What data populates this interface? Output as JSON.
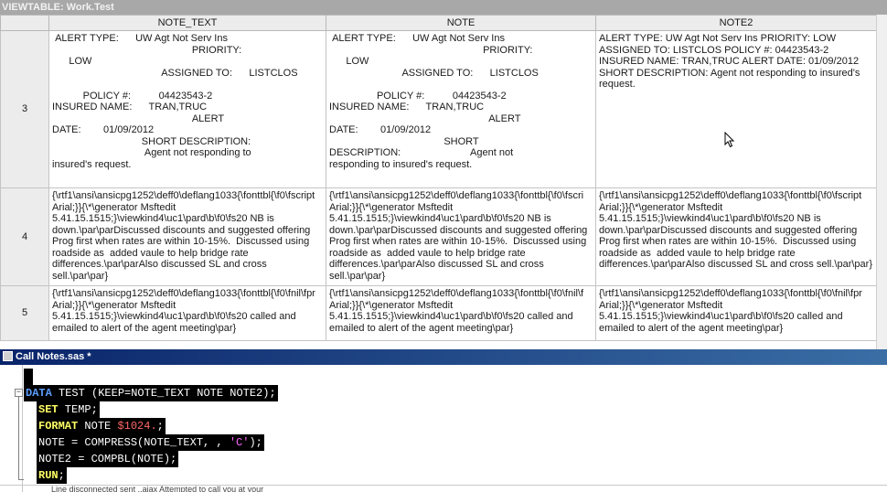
{
  "viewtable_title": "VIEWTABLE: Work.Test",
  "columns": [
    "NOTE_TEXT",
    "NOTE",
    "NOTE2"
  ],
  "rows": [
    {
      "num": "3",
      "note_text": " ALERT TYPE:      UW Agt Not Serv Ins\n                                                  PRIORITY:\n      LOW\n                                       ASSIGNED TO:      LISTCLOS\n\n           POLICY #:          04423543-2\nINSURED NAME:      TRAN,TRUC\n                                                  ALERT\nDATE:        01/09/2012\n                                SHORT DESCRIPTION:\n                                 Agent not responding to\ninsured's request.",
      "note": " ALERT TYPE:      UW Agt Not Serv Ins\n                                                       PRIORITY:\n      LOW\n                          ASSIGNED TO:      LISTCLOS\n\n                 POLICY #:          04423543-2\nINSURED NAME:      TRAN,TRUC\n                                                         ALERT\nDATE:        01/09/2012\n                                         SHORT\nDESCRIPTION:                         Agent not\nresponding to insured's request.",
      "note2": "ALERT TYPE: UW Agt Not Serv Ins PRIORITY: LOW ASSIGNED TO: LISTCLOS POLICY #: 04423543-2 INSURED NAME: TRAN,TRUC ALERT DATE: 01/09/2012 SHORT DESCRIPTION: Agent not responding to insured's request."
    },
    {
      "num": "4",
      "note_text": "{\\rtf1\\ansi\\ansicpg1252\\deff0\\deflang1033{\\fonttbl{\\f0\\fscript Arial;}}{\\*\\generator Msftedit 5.41.15.1515;}\\viewkind4\\uc1\\pard\\b\\f0\\fs20 NB is down.\\par\\parDiscussed discounts and suggested offering Prog first when rates are within 10-15%.  Discussed using roadside as  added vaule to help bridge rate differences.\\par\\parAlso discussed SL and cross sell.\\par\\par}",
      "note": "{\\rtf1\\ansi\\ansicpg1252\\deff0\\deflang1033{\\fonttbl{\\f0\\fscri Arial;}}{\\*\\generator Msftedit 5.41.15.1515;}\\viewkind4\\uc1\\pard\\b\\f0\\fs20 NB is down.\\par\\parDiscussed discounts and suggested offering Prog first when rates are within 10-15%.  Discussed using roadside as  added vaule to help bridge rate differences.\\par\\parAlso discussed SL and cross sell.\\par\\par}",
      "note2": "{\\rtf1\\ansi\\ansicpg1252\\deff0\\deflang1033{\\fonttbl{\\f0\\fscript Arial;}}{\\*\\generator Msftedit 5.41.15.1515;}\\viewkind4\\uc1\\pard\\b\\f0\\fs20 NB is down.\\par\\parDiscussed discounts and suggested offering Prog first when rates are within 10-15%.  Discussed using roadside as  added vaule to help bridge rate differences.\\par\\parAlso discussed SL and cross sell.\\par\\par}"
    },
    {
      "num": "5",
      "note_text": "{\\rtf1\\ansi\\ansicpg1252\\deff0\\deflang1033{\\fonttbl{\\f0\\fnil\\fpr Arial;}}{\\*\\generator Msftedit 5.41.15.1515;}\\viewkind4\\uc1\\pard\\b\\f0\\fs20 called and emailed to alert of the agent meeting\\par}",
      "note": "{\\rtf1\\ansi\\ansicpg1252\\deff0\\deflang1033{\\fonttbl{\\f0\\fnil\\f Arial;}}{\\*\\generator Msftedit 5.41.15.1515;}\\viewkind4\\uc1\\pard\\b\\f0\\fs20 called and emailed to alert of the agent meeting\\par}",
      "note2": "{\\rtf1\\ansi\\ansicpg1252\\deff0\\deflang1033{\\fonttbl{\\f0\\fnil\\fpr Arial;}}{\\*\\generator Msftedit 5.41.15.1515;}\\viewkind4\\uc1\\pard\\b\\f0\\fs20 called and emailed to alert of the agent meeting\\par}"
    }
  ],
  "editor_title": "Call Notes.sas *",
  "code": {
    "line1_kw": "DATA",
    "line1_rest": " TEST (KEEP=NOTE_TEXT NOTE NOTE2);",
    "line2_kw": "SET",
    "line2_rest": " TEMP;",
    "line3_kw": "FORMAT",
    "line3_mid": " NOTE ",
    "line3_fmt": "$1024.",
    "line3_end": ";",
    "line4_pre": "NOTE = COMPRESS(NOTE_TEXT, , ",
    "line4_str": "'C'",
    "line4_end": ");",
    "line5": "NOTE2 = COMPBL(NOTE);",
    "line6_kw": "RUN",
    "line6_end": ";"
  },
  "lower_text": "Line disconnected  sent  ..ajax  Attempted to call you at your"
}
